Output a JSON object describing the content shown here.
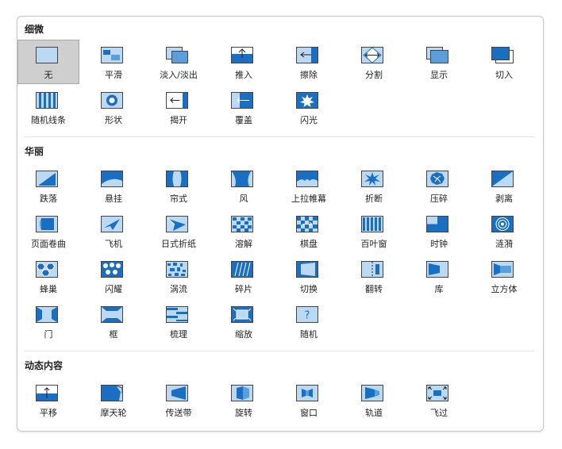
{
  "sections": [
    {
      "title": "细微",
      "items": [
        {
          "label": "无",
          "icon": "none-icon",
          "selected": true
        },
        {
          "label": "平滑",
          "icon": "morph-icon"
        },
        {
          "label": "淡入/淡出",
          "icon": "fade-icon"
        },
        {
          "label": "推入",
          "icon": "push-icon"
        },
        {
          "label": "擦除",
          "icon": "wipe-icon"
        },
        {
          "label": "分割",
          "icon": "split-icon"
        },
        {
          "label": "显示",
          "icon": "reveal-icon"
        },
        {
          "label": "切入",
          "icon": "cut-icon"
        },
        {
          "label": "随机线条",
          "icon": "random-bars-icon"
        },
        {
          "label": "形状",
          "icon": "shape-icon"
        },
        {
          "label": "揭开",
          "icon": "uncover-icon"
        },
        {
          "label": "覆盖",
          "icon": "cover-icon"
        },
        {
          "label": "闪光",
          "icon": "flash-icon"
        }
      ]
    },
    {
      "title": "华丽",
      "items": [
        {
          "label": "跌落",
          "icon": "fall-over-icon"
        },
        {
          "label": "悬挂",
          "icon": "drape-icon"
        },
        {
          "label": "帘式",
          "icon": "curtains-icon"
        },
        {
          "label": "风",
          "icon": "wind-icon"
        },
        {
          "label": "上拉帷幕",
          "icon": "prestige-icon"
        },
        {
          "label": "折断",
          "icon": "fracture-icon"
        },
        {
          "label": "压碎",
          "icon": "crush-icon"
        },
        {
          "label": "剥离",
          "icon": "peel-off-icon"
        },
        {
          "label": "页面卷曲",
          "icon": "page-curl-icon"
        },
        {
          "label": "飞机",
          "icon": "airplane-icon"
        },
        {
          "label": "日式折纸",
          "icon": "origami-icon"
        },
        {
          "label": "溶解",
          "icon": "dissolve-icon"
        },
        {
          "label": "棋盘",
          "icon": "checkerboard-icon"
        },
        {
          "label": "百叶窗",
          "icon": "blinds-icon"
        },
        {
          "label": "时钟",
          "icon": "clock-icon"
        },
        {
          "label": "涟漪",
          "icon": "ripple-icon"
        },
        {
          "label": "蜂巢",
          "icon": "honeycomb-icon"
        },
        {
          "label": "闪耀",
          "icon": "glitter-icon"
        },
        {
          "label": "涡流",
          "icon": "vortex-icon"
        },
        {
          "label": "碎片",
          "icon": "shred-icon"
        },
        {
          "label": "切换",
          "icon": "switch-icon"
        },
        {
          "label": "翻转",
          "icon": "flip-icon"
        },
        {
          "label": "库",
          "icon": "gallery-icon"
        },
        {
          "label": "立方体",
          "icon": "cube-icon"
        },
        {
          "label": "门",
          "icon": "doors-icon"
        },
        {
          "label": "框",
          "icon": "box-icon"
        },
        {
          "label": "梳理",
          "icon": "comb-icon"
        },
        {
          "label": "缩放",
          "icon": "zoom-icon"
        },
        {
          "label": "随机",
          "icon": "random-icon"
        }
      ]
    },
    {
      "title": "动态内容",
      "items": [
        {
          "label": "平移",
          "icon": "pan-icon"
        },
        {
          "label": "摩天轮",
          "icon": "ferris-wheel-icon"
        },
        {
          "label": "传送带",
          "icon": "conveyor-icon"
        },
        {
          "label": "旋转",
          "icon": "rotate-icon"
        },
        {
          "label": "窗口",
          "icon": "window-icon"
        },
        {
          "label": "轨道",
          "icon": "orbit-icon"
        },
        {
          "label": "飞过",
          "icon": "fly-through-icon"
        }
      ]
    }
  ],
  "colors": {
    "accent": "#1b6fc2",
    "light": "#bcd9f3",
    "mid": "#5b9edc",
    "border": "#2a6fb8"
  }
}
